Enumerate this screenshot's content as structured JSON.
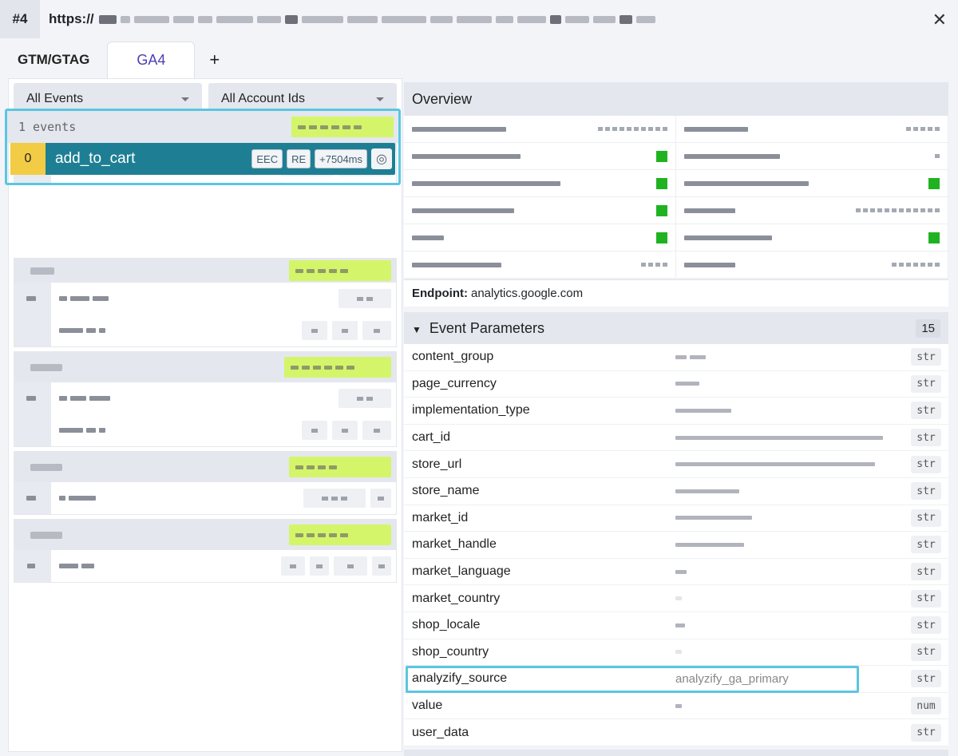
{
  "titlebar": {
    "number": "#4",
    "url_prefix": "https://"
  },
  "tabs": [
    {
      "label": "GTM/GTAG",
      "active": false
    },
    {
      "label": "GA4",
      "active": true
    }
  ],
  "tab_add": "+",
  "filters": {
    "events": "All Events",
    "accounts": "All Account Ids"
  },
  "selected_group": {
    "count_label": "1 events",
    "event": {
      "index": "0",
      "name": "add_to_cart",
      "chips": [
        "EEC",
        "RE",
        "+7504ms"
      ]
    }
  },
  "overview": {
    "title": "Overview",
    "endpoint_label": "Endpoint:",
    "endpoint_value": "analytics.google.com"
  },
  "event_params": {
    "title": "Event Parameters",
    "count": "15",
    "rows": [
      {
        "key": "content_group",
        "value": "",
        "type": "str"
      },
      {
        "key": "page_currency",
        "value": "",
        "type": "str"
      },
      {
        "key": "implementation_type",
        "value": "",
        "type": "str"
      },
      {
        "key": "cart_id",
        "value": "",
        "type": "str"
      },
      {
        "key": "store_url",
        "value": "",
        "type": "str"
      },
      {
        "key": "store_name",
        "value": "",
        "type": "str"
      },
      {
        "key": "market_id",
        "value": "",
        "type": "str"
      },
      {
        "key": "market_handle",
        "value": "",
        "type": "str"
      },
      {
        "key": "market_language",
        "value": "",
        "type": "str"
      },
      {
        "key": "market_country",
        "value": "",
        "type": "str"
      },
      {
        "key": "shop_locale",
        "value": "",
        "type": "str"
      },
      {
        "key": "shop_country",
        "value": "",
        "type": "str"
      },
      {
        "key": "analyzify_source",
        "value": "analyzify_ga_primary",
        "type": "str"
      },
      {
        "key": "value",
        "value": "",
        "type": "num"
      },
      {
        "key": "user_data",
        "value": "",
        "type": "str"
      }
    ]
  }
}
